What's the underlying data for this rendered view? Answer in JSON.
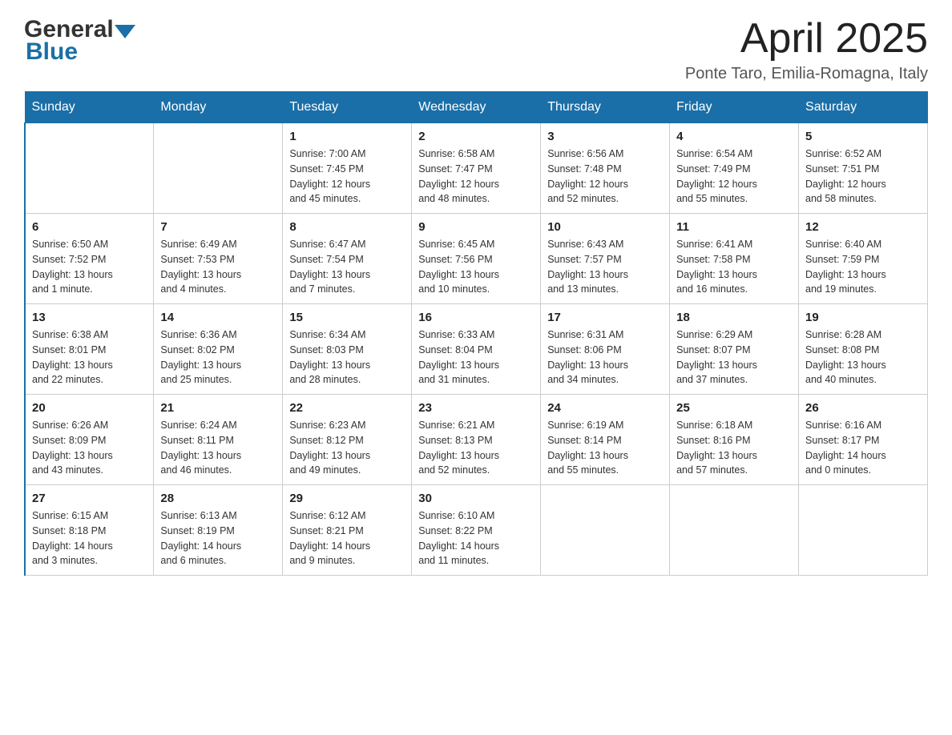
{
  "header": {
    "logo_general": "General",
    "logo_blue": "Blue",
    "title": "April 2025",
    "subtitle": "Ponte Taro, Emilia-Romagna, Italy"
  },
  "calendar": {
    "days_of_week": [
      "Sunday",
      "Monday",
      "Tuesday",
      "Wednesday",
      "Thursday",
      "Friday",
      "Saturday"
    ],
    "weeks": [
      [
        {
          "day": "",
          "info": ""
        },
        {
          "day": "",
          "info": ""
        },
        {
          "day": "1",
          "info": "Sunrise: 7:00 AM\nSunset: 7:45 PM\nDaylight: 12 hours\nand 45 minutes."
        },
        {
          "day": "2",
          "info": "Sunrise: 6:58 AM\nSunset: 7:47 PM\nDaylight: 12 hours\nand 48 minutes."
        },
        {
          "day": "3",
          "info": "Sunrise: 6:56 AM\nSunset: 7:48 PM\nDaylight: 12 hours\nand 52 minutes."
        },
        {
          "day": "4",
          "info": "Sunrise: 6:54 AM\nSunset: 7:49 PM\nDaylight: 12 hours\nand 55 minutes."
        },
        {
          "day": "5",
          "info": "Sunrise: 6:52 AM\nSunset: 7:51 PM\nDaylight: 12 hours\nand 58 minutes."
        }
      ],
      [
        {
          "day": "6",
          "info": "Sunrise: 6:50 AM\nSunset: 7:52 PM\nDaylight: 13 hours\nand 1 minute."
        },
        {
          "day": "7",
          "info": "Sunrise: 6:49 AM\nSunset: 7:53 PM\nDaylight: 13 hours\nand 4 minutes."
        },
        {
          "day": "8",
          "info": "Sunrise: 6:47 AM\nSunset: 7:54 PM\nDaylight: 13 hours\nand 7 minutes."
        },
        {
          "day": "9",
          "info": "Sunrise: 6:45 AM\nSunset: 7:56 PM\nDaylight: 13 hours\nand 10 minutes."
        },
        {
          "day": "10",
          "info": "Sunrise: 6:43 AM\nSunset: 7:57 PM\nDaylight: 13 hours\nand 13 minutes."
        },
        {
          "day": "11",
          "info": "Sunrise: 6:41 AM\nSunset: 7:58 PM\nDaylight: 13 hours\nand 16 minutes."
        },
        {
          "day": "12",
          "info": "Sunrise: 6:40 AM\nSunset: 7:59 PM\nDaylight: 13 hours\nand 19 minutes."
        }
      ],
      [
        {
          "day": "13",
          "info": "Sunrise: 6:38 AM\nSunset: 8:01 PM\nDaylight: 13 hours\nand 22 minutes."
        },
        {
          "day": "14",
          "info": "Sunrise: 6:36 AM\nSunset: 8:02 PM\nDaylight: 13 hours\nand 25 minutes."
        },
        {
          "day": "15",
          "info": "Sunrise: 6:34 AM\nSunset: 8:03 PM\nDaylight: 13 hours\nand 28 minutes."
        },
        {
          "day": "16",
          "info": "Sunrise: 6:33 AM\nSunset: 8:04 PM\nDaylight: 13 hours\nand 31 minutes."
        },
        {
          "day": "17",
          "info": "Sunrise: 6:31 AM\nSunset: 8:06 PM\nDaylight: 13 hours\nand 34 minutes."
        },
        {
          "day": "18",
          "info": "Sunrise: 6:29 AM\nSunset: 8:07 PM\nDaylight: 13 hours\nand 37 minutes."
        },
        {
          "day": "19",
          "info": "Sunrise: 6:28 AM\nSunset: 8:08 PM\nDaylight: 13 hours\nand 40 minutes."
        }
      ],
      [
        {
          "day": "20",
          "info": "Sunrise: 6:26 AM\nSunset: 8:09 PM\nDaylight: 13 hours\nand 43 minutes."
        },
        {
          "day": "21",
          "info": "Sunrise: 6:24 AM\nSunset: 8:11 PM\nDaylight: 13 hours\nand 46 minutes."
        },
        {
          "day": "22",
          "info": "Sunrise: 6:23 AM\nSunset: 8:12 PM\nDaylight: 13 hours\nand 49 minutes."
        },
        {
          "day": "23",
          "info": "Sunrise: 6:21 AM\nSunset: 8:13 PM\nDaylight: 13 hours\nand 52 minutes."
        },
        {
          "day": "24",
          "info": "Sunrise: 6:19 AM\nSunset: 8:14 PM\nDaylight: 13 hours\nand 55 minutes."
        },
        {
          "day": "25",
          "info": "Sunrise: 6:18 AM\nSunset: 8:16 PM\nDaylight: 13 hours\nand 57 minutes."
        },
        {
          "day": "26",
          "info": "Sunrise: 6:16 AM\nSunset: 8:17 PM\nDaylight: 14 hours\nand 0 minutes."
        }
      ],
      [
        {
          "day": "27",
          "info": "Sunrise: 6:15 AM\nSunset: 8:18 PM\nDaylight: 14 hours\nand 3 minutes."
        },
        {
          "day": "28",
          "info": "Sunrise: 6:13 AM\nSunset: 8:19 PM\nDaylight: 14 hours\nand 6 minutes."
        },
        {
          "day": "29",
          "info": "Sunrise: 6:12 AM\nSunset: 8:21 PM\nDaylight: 14 hours\nand 9 minutes."
        },
        {
          "day": "30",
          "info": "Sunrise: 6:10 AM\nSunset: 8:22 PM\nDaylight: 14 hours\nand 11 minutes."
        },
        {
          "day": "",
          "info": ""
        },
        {
          "day": "",
          "info": ""
        },
        {
          "day": "",
          "info": ""
        }
      ]
    ]
  }
}
